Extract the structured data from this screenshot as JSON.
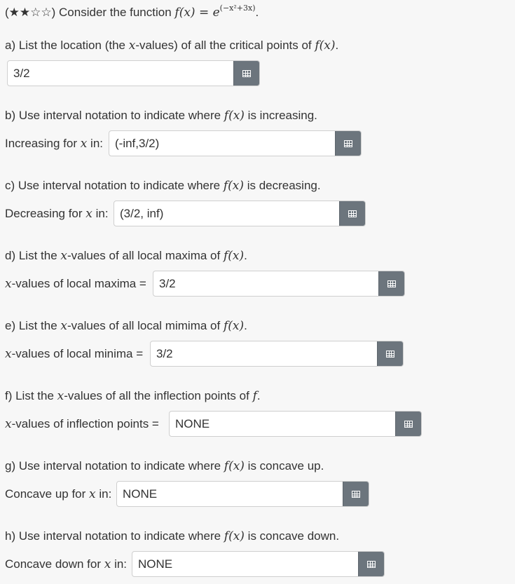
{
  "header": {
    "stars": "(★★☆☆)",
    "text": " Consider the function ",
    "func": "f(x) = e",
    "exponent": "(−x²+3x)",
    "end": "."
  },
  "questions": [
    {
      "prompt_pre": "a) List the location (the ",
      "prompt_math": "x",
      "prompt_post": "-values) of all the critical points of ",
      "prompt_math2": "f(x)",
      "prompt_end": ".",
      "label_pre": "",
      "label_math": "",
      "label_post": "",
      "value": "3/2"
    },
    {
      "prompt_pre": "b) Use interval notation to indicate where ",
      "prompt_math": "f(x)",
      "prompt_post": " is increasing.",
      "label_pre": "Increasing for ",
      "label_math": "x",
      "label_post": " in:",
      "value": "(-inf,3/2)"
    },
    {
      "prompt_pre": "c) Use interval notation to indicate where ",
      "prompt_math": "f(x)",
      "prompt_post": " is decreasing.",
      "label_pre": "Decreasing for ",
      "label_math": "x",
      "label_post": " in:",
      "value": "(3/2, inf)"
    },
    {
      "prompt_pre": "d) List the ",
      "prompt_math": "x",
      "prompt_post": "-values of all local maxima of ",
      "prompt_math2": "f(x)",
      "prompt_end": ".",
      "label_pre": "",
      "label_math": "x",
      "label_post": "-values of local maxima =",
      "value": "3/2"
    },
    {
      "prompt_pre": "e) List the ",
      "prompt_math": "x",
      "prompt_post": "-values of all local mimima of ",
      "prompt_math2": "f(x)",
      "prompt_end": ".",
      "label_pre": "",
      "label_math": "x",
      "label_post": "-values of local minima =",
      "value": "3/2"
    },
    {
      "prompt_pre": "f) List the ",
      "prompt_math": "x",
      "prompt_post": "-values of all the inflection points of ",
      "prompt_math2": "f",
      "prompt_end": ".",
      "label_pre": "",
      "label_math": "x",
      "label_post": "-values of inflection points =",
      "value": "NONE"
    },
    {
      "prompt_pre": "g) Use interval notation to indicate where ",
      "prompt_math": "f(x)",
      "prompt_post": " is concave up.",
      "label_pre": "Concave up for ",
      "label_math": "x",
      "label_post": " in:",
      "value": "NONE"
    },
    {
      "prompt_pre": "h) Use interval notation to indicate where ",
      "prompt_math": "f(x)",
      "prompt_post": " is concave down.",
      "label_pre": "Concave down for ",
      "label_math": "x",
      "label_post": " in:",
      "value": "NONE"
    }
  ],
  "icon": "matrix-grid-icon"
}
